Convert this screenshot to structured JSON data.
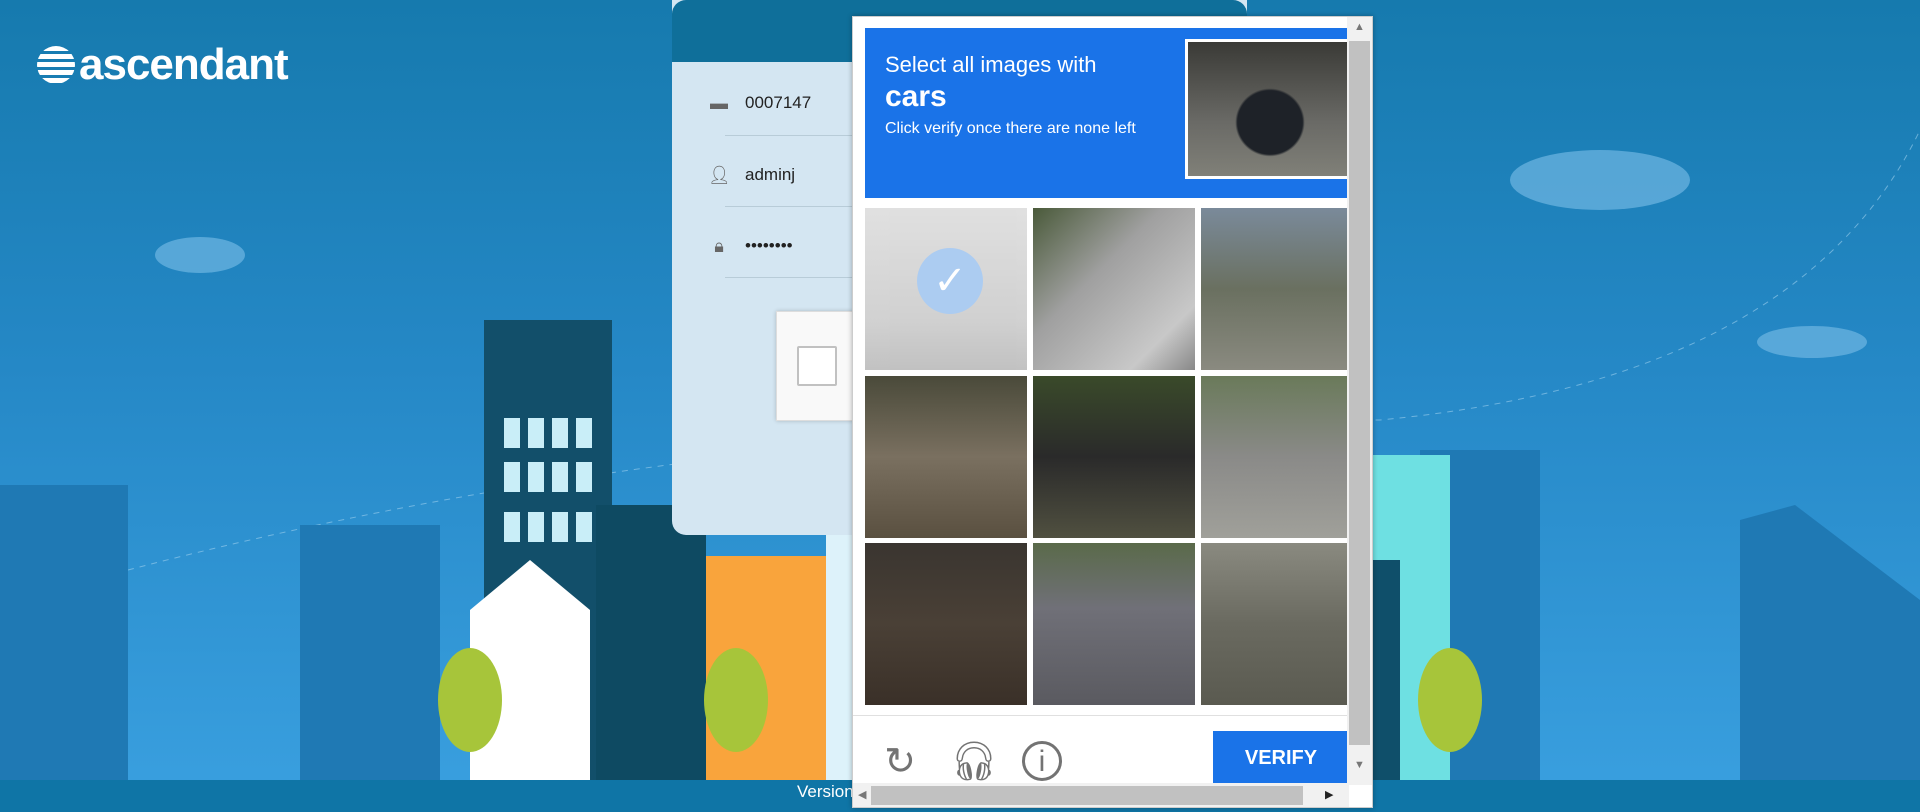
{
  "brand": {
    "logo_text": "ascendant"
  },
  "login": {
    "fields": [
      {
        "icon": "id-card-icon",
        "value": "0007147"
      },
      {
        "icon": "user-icon",
        "value": "adminj"
      },
      {
        "icon": "lock-icon",
        "value": "••••••••"
      }
    ]
  },
  "captcha": {
    "prompt_line1": "Select all images with",
    "target": "cars",
    "prompt_line3": "Click verify once there are none left",
    "tiles": [
      {
        "selected": true
      },
      {
        "selected": false
      },
      {
        "selected": false
      },
      {
        "selected": false
      },
      {
        "selected": false
      },
      {
        "selected": false
      },
      {
        "selected": false
      },
      {
        "selected": false
      },
      {
        "selected": false
      }
    ],
    "verify_label": "VERIFY",
    "icons": [
      "reload-icon",
      "audio-headphones-icon",
      "info-icon"
    ],
    "check_glyph": "✓"
  },
  "footer": {
    "version_text": "Version"
  },
  "colors": {
    "accent": "#1a73e8",
    "sky": "#2588c6"
  }
}
